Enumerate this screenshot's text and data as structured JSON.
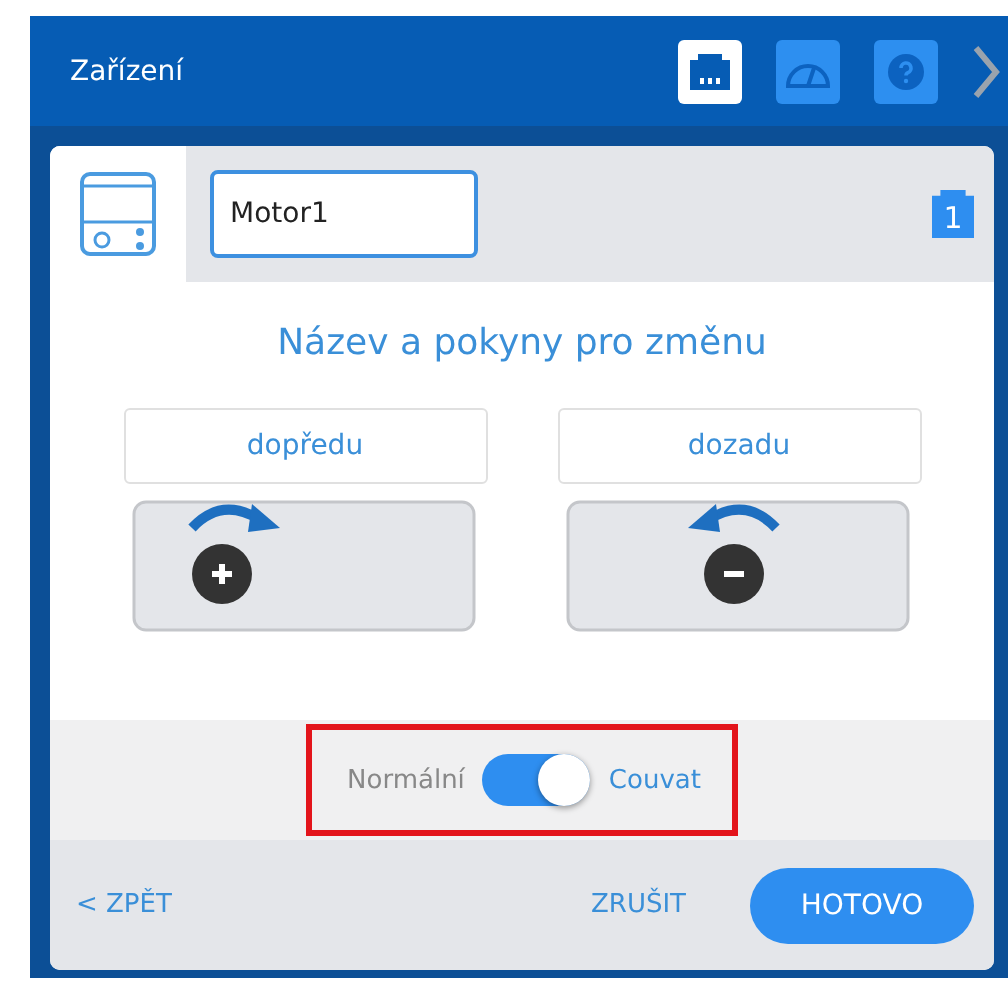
{
  "header": {
    "title": "Zařízení",
    "buttons": [
      {
        "selected": true
      },
      {
        "selected": false
      },
      {
        "selected": false
      }
    ]
  },
  "device": {
    "name": "Motor1",
    "port": "1"
  },
  "heading": "Název a pokyny pro změnu",
  "directions": [
    {
      "label": "dopředu",
      "kind": "plus"
    },
    {
      "label": "dozadu",
      "kind": "minus"
    }
  ],
  "toggle": {
    "off_label": "Normální",
    "on_label": "Couvat",
    "on": true,
    "highlighted": true
  },
  "footer": {
    "back": "< ZPĚT",
    "cancel": "ZRUŠIT",
    "done": "HOTOVO"
  }
}
